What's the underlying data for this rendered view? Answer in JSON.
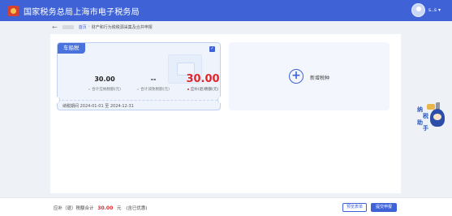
{
  "header": {
    "title": "国家税务总局上海市电子税务局",
    "user_name": "s..s",
    "user_caret": "▾"
  },
  "breadcrumb": {
    "back": "←",
    "home": "首页",
    "separator": "›",
    "current": "财产和行为税税源采集及合并申报"
  },
  "tax_card": {
    "tag": "车船税",
    "check": "✓",
    "tax_amount": {
      "value": "30.00",
      "label": "合计应纳税额(元)"
    },
    "reduction": {
      "value": "--",
      "label": "合计减免税额(元)"
    },
    "refund": {
      "value": "30.00",
      "label": "应补(退)税额(元)"
    },
    "period": "纳税期间 2024-01-01 至 2024-12-31"
  },
  "add_card": {
    "icon": "+",
    "label": "新增税种"
  },
  "assistant": {
    "chars": [
      "纳",
      "税",
      "助",
      "手"
    ]
  },
  "footer": {
    "total_label": "应补（退）税额合计",
    "total_amount": "30.00",
    "total_unit": "元",
    "total_note": "(含已优惠)",
    "preview_button": "预览表单",
    "submit_button": "提交申报"
  },
  "colors": {
    "header": "#3f63d6",
    "accent": "#3f63d6",
    "amount_red": "#e0262b",
    "card_tag": "#4a72dd"
  }
}
